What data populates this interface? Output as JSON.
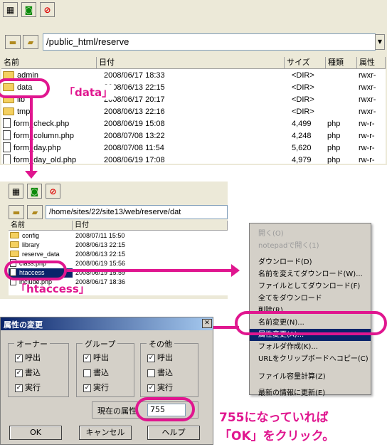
{
  "top_window": {
    "path": "/public_html/reserve",
    "columns": [
      "名前",
      "日付",
      "サイズ",
      "種類",
      "属性"
    ],
    "rows": [
      {
        "icon": "folder",
        "name": "admin",
        "date": "2008/06/17 18:33",
        "size": "<DIR>",
        "type": "",
        "attr": "rwxr-"
      },
      {
        "icon": "folder",
        "name": "data",
        "date": "2008/06/13 22:15",
        "size": "<DIR>",
        "type": "",
        "attr": "rwxr-"
      },
      {
        "icon": "folder",
        "name": "lib",
        "date": "2008/06/17 20:17",
        "size": "<DIR>",
        "type": "",
        "attr": "rwxr-"
      },
      {
        "icon": "folder",
        "name": "tmp",
        "date": "2008/06/13 22:16",
        "size": "<DIR>",
        "type": "",
        "attr": "rwxr-"
      },
      {
        "icon": "file",
        "name": "form_check.php",
        "date": "2008/06/19 15:08",
        "size": "4,499",
        "type": "php",
        "attr": "rw-r-"
      },
      {
        "icon": "file",
        "name": "form_column.php",
        "date": "2008/07/08 13:22",
        "size": "4,248",
        "type": "php",
        "attr": "rw-r-"
      },
      {
        "icon": "file",
        "name": "form_day.php",
        "date": "2008/07/08 11:54",
        "size": "5,620",
        "type": "php",
        "attr": "rw-r-"
      },
      {
        "icon": "file",
        "name": "form_day_old.php",
        "date": "2008/06/19 17:08",
        "size": "4,979",
        "type": "php",
        "attr": "rw-r-"
      }
    ]
  },
  "callout_data": "「data」",
  "middle_window": {
    "path": "/home/sites/22/site13/web/reserve/dat",
    "columns": [
      "名前",
      "日付"
    ],
    "rows": [
      {
        "icon": "folder",
        "name": "config",
        "date": "2008/07/11 15:50",
        "selected": false
      },
      {
        "icon": "folder",
        "name": "library",
        "date": "2008/06/13 22:15",
        "selected": false
      },
      {
        "icon": "folder",
        "name": "reserve_data",
        "date": "2008/06/13 22:15",
        "selected": false
      },
      {
        "icon": "file",
        "name": "class.php",
        "date": "2008/06/19 15:56",
        "selected": false
      },
      {
        "icon": "file",
        "name": "htaccess",
        "date": "2008/06/19 15:59",
        "selected": true
      },
      {
        "icon": "file",
        "name": "include.php",
        "date": "2008/06/17 18:36",
        "selected": false
      }
    ]
  },
  "callout_htaccess": "「htaccess」",
  "context_menu": {
    "items": [
      {
        "label": "開く(O)",
        "disabled": true
      },
      {
        "label": "notepadで開く(1)",
        "disabled": true
      },
      {
        "label": "ダウンロード(D)",
        "disabled": false
      },
      {
        "label": "名前を変えてダウンロード(W)...",
        "disabled": false
      },
      {
        "label": "ファイルとしてダウンロード(F)",
        "disabled": false
      },
      {
        "label": "全てをダウンロード",
        "disabled": false
      },
      {
        "label": "削除(R)",
        "disabled": false
      },
      {
        "label": "名前変更(N)...",
        "disabled": false
      },
      {
        "label": "属性変更(A)...",
        "disabled": false,
        "highlighted": true
      },
      {
        "label": "フォルダ作成(K)...",
        "disabled": false
      },
      {
        "label": "URLをクリップボードへコピー(C)",
        "disabled": false
      },
      {
        "label": "ファイル容量計算(Z)",
        "disabled": false
      },
      {
        "label": "最新の情報に更新(E)",
        "disabled": false
      }
    ]
  },
  "dialog": {
    "title": "属性の変更",
    "groups": [
      {
        "title": "オーナー",
        "items": [
          {
            "label": "呼出",
            "checked": true
          },
          {
            "label": "書込",
            "checked": true
          },
          {
            "label": "実行",
            "checked": true
          }
        ]
      },
      {
        "title": "グループ",
        "items": [
          {
            "label": "呼出",
            "checked": true
          },
          {
            "label": "書込",
            "checked": false
          },
          {
            "label": "実行",
            "checked": true
          }
        ]
      },
      {
        "title": "その他",
        "items": [
          {
            "label": "呼出",
            "checked": true
          },
          {
            "label": "書込",
            "checked": false
          },
          {
            "label": "実行",
            "checked": true
          }
        ]
      }
    ],
    "current_label": "現在の属性",
    "current_value": "755",
    "ok": "OK",
    "cancel": "キャンセル",
    "help": "ヘルプ"
  },
  "instruction_line1": "755になっていれば",
  "instruction_line2": "「OK」をクリック。",
  "colors": {
    "accent": "#e0168f",
    "selection": "#0a246a",
    "panel": "#d4d0c8"
  }
}
